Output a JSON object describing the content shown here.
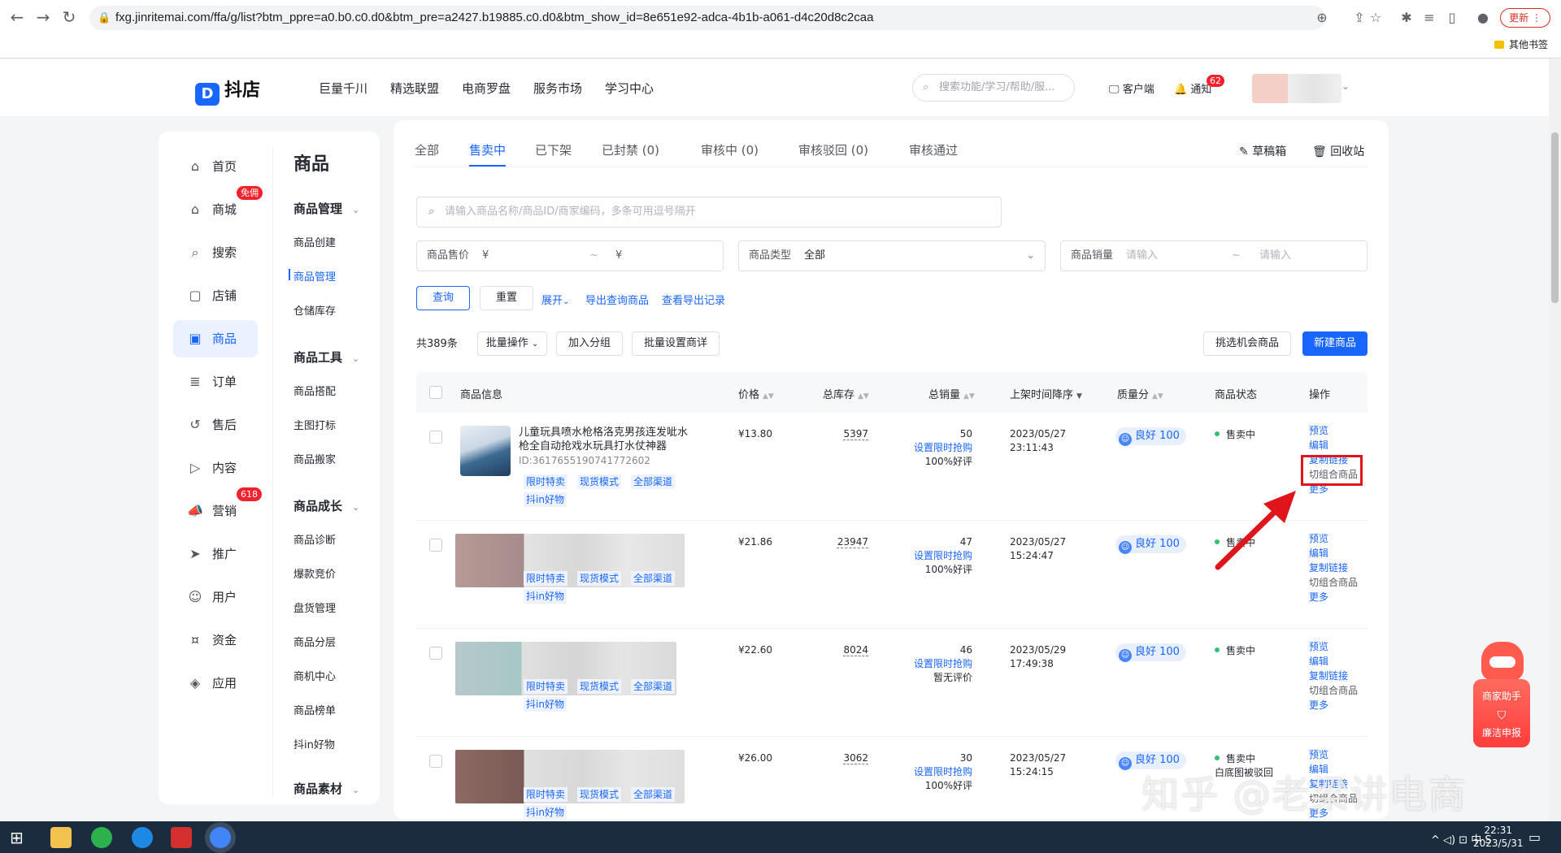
{
  "browser": {
    "url": "fxg.jinritemai.com/ffa/g/list?btm_ppre=a0.b0.c0.d0&btm_pre=a2427.b19885.c0.d0&btm_show_id=8e651e92-adca-4b1b-a061-d4c20d8c2caa",
    "update_label": "更新",
    "bookmark_label": "其他书签"
  },
  "header": {
    "logo": "抖店",
    "nav": [
      "巨量千川",
      "精选联盟",
      "电商罗盘",
      "服务市场",
      "学习中心"
    ],
    "search_placeholder": "搜索功能/学习/帮助/服...",
    "client_label": "客户端",
    "notice_label": "通知",
    "notice_count": "62"
  },
  "sidebar": {
    "items": [
      {
        "label": "首页",
        "icon": "home-icon"
      },
      {
        "label": "商城",
        "icon": "shop-icon",
        "badge": "免佣"
      },
      {
        "label": "搜索",
        "icon": "search-icon"
      },
      {
        "label": "店铺",
        "icon": "store-icon"
      },
      {
        "label": "商品",
        "icon": "product-icon",
        "active": true
      },
      {
        "label": "订单",
        "icon": "order-icon"
      },
      {
        "label": "售后",
        "icon": "aftersale-icon"
      },
      {
        "label": "内容",
        "icon": "content-icon"
      },
      {
        "label": "营销",
        "icon": "marketing-icon",
        "badge": "618"
      },
      {
        "label": "推广",
        "icon": "promote-icon"
      },
      {
        "label": "用户",
        "icon": "user-icon"
      },
      {
        "label": "资金",
        "icon": "funds-icon"
      },
      {
        "label": "应用",
        "icon": "app-icon"
      }
    ],
    "sub_title": "商品",
    "groups": [
      {
        "title": "商品管理",
        "items": [
          "商品创建",
          "商品管理",
          "仓储库存"
        ]
      },
      {
        "title": "商品工具",
        "items": [
          "商品搭配",
          "主图打标",
          "商品搬家"
        ]
      },
      {
        "title": "商品成长",
        "items": [
          "商品诊断",
          "爆款竞价",
          "盘货管理",
          "商品分层",
          "商机中心",
          "商品榜单",
          "抖in好物"
        ]
      },
      {
        "title": "商品素材",
        "items": []
      }
    ]
  },
  "tabs": [
    "全部",
    "售卖中",
    "已下架",
    "已封禁 (0)",
    "审核中 (0)",
    "审核驳回 (0)",
    "审核通过"
  ],
  "draft_label": "草稿箱",
  "recycle_label": "回收站",
  "filters": {
    "search_placeholder": "请输入商品名称/商品ID/商家编码，多条可用逗号隔开",
    "price_label": "商品售价",
    "currency": "¥",
    "tilde": "~",
    "type_label": "商品类型",
    "type_value": "全部",
    "sales_label": "商品销量",
    "sales_placeholder": "请输入"
  },
  "actions": {
    "query": "查询",
    "reset": "重置",
    "expand": "展开",
    "export": "导出查询商品",
    "export_log": "查看导出记录",
    "total": "共389条",
    "batch": "批量操作",
    "add_group": "加入分组",
    "batch_detail": "批量设置商详",
    "opportunity": "挑选机会商品",
    "new_product": "新建商品"
  },
  "table": {
    "headers": [
      "商品信息",
      "价格",
      "总库存",
      "总销量",
      "上架时间降序",
      "质量分",
      "商品状态",
      "操作"
    ],
    "rows": [
      {
        "name": "儿童玩具喷水枪格洛克男孩连发呲水枪全自动抢戏水玩具打水仗神器",
        "id": "ID:3617655190741772602",
        "price": "¥13.80",
        "stock": "5397",
        "sales": "50",
        "rate": "100%好评",
        "date": "2023/05/27",
        "time": "23:11:43",
        "quality": "良好 100",
        "status": "售卖中"
      },
      {
        "name": "",
        "id": "",
        "price": "¥21.86",
        "stock": "23947",
        "sales": "47",
        "rate": "100%好评",
        "date": "2023/05/27",
        "time": "15:24:47",
        "quality": "良好 100",
        "status": "售卖中"
      },
      {
        "name": "",
        "id": "",
        "price": "¥22.60",
        "stock": "8024",
        "sales": "46",
        "rate": "暂无评价",
        "date": "2023/05/29",
        "time": "17:49:38",
        "quality": "良好 100",
        "status": "售卖中"
      },
      {
        "name": "",
        "id": "",
        "price": "¥26.00",
        "stock": "3062",
        "sales": "30",
        "rate": "100%好评",
        "date": "2023/05/27",
        "time": "15:24:15",
        "quality": "良好 100",
        "status": "售卖中",
        "extra_status": "白底图被驳回"
      }
    ],
    "tags": [
      "限时特卖",
      "现货模式",
      "全部渠道",
      "抖in好物"
    ],
    "set_flash": "设置限时抢购",
    "ops": [
      "预览",
      "编辑",
      "复制链接",
      "切组合商品",
      "更多"
    ]
  },
  "assistant": {
    "title": "商家助手",
    "report": "廉洁申报"
  },
  "watermark": "知乎 @老梁讲电商",
  "taskbar": {
    "time": "22:31",
    "date": "2023/5/31",
    "ime": "中"
  },
  "colors": {
    "accent": "#1966ff",
    "highlight": "#e0151c",
    "status_green": "#30c26f"
  }
}
